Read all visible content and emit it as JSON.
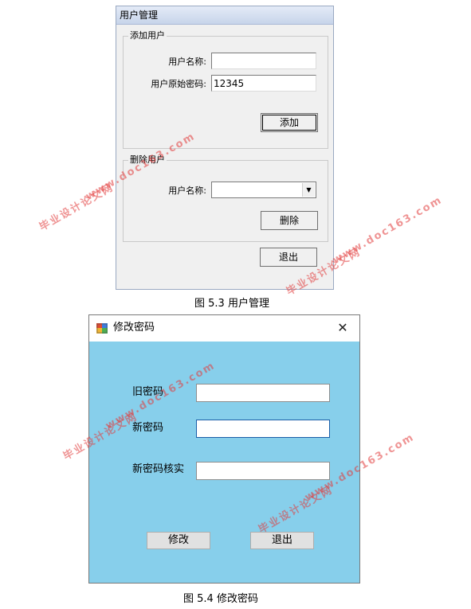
{
  "user_management": {
    "title": "用户管理",
    "add_group": {
      "legend": "添加用户",
      "username_label": "用户名称:",
      "username_value": "",
      "password_label": "用户原始密码:",
      "password_value": "12345",
      "add_button": "添加"
    },
    "delete_group": {
      "legend": "删除用户",
      "username_label": "用户名称:",
      "username_selected": "",
      "delete_button": "删除"
    },
    "exit_button": "退出",
    "caption": "图 5.3 用户管理"
  },
  "change_password": {
    "title": "修改密码",
    "close_glyph": "✕",
    "old_password_label": "旧密码",
    "new_password_label": "新密码",
    "confirm_password_label": "新密码核实",
    "modify_button": "修改",
    "exit_button": "退出",
    "caption": "图 5.4 修改密码"
  },
  "watermark": {
    "line1": "毕业设计论文网",
    "line2": "www.doc163.com"
  }
}
